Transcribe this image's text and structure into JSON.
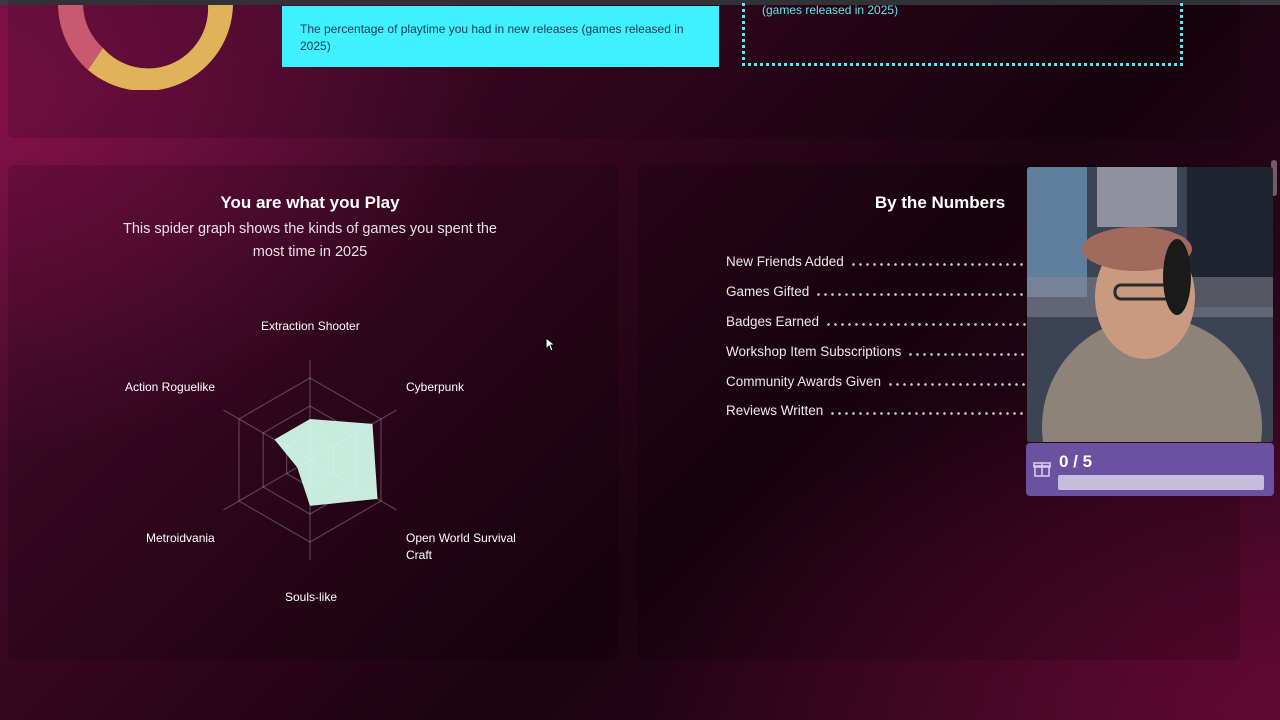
{
  "top": {
    "tooltip_text": "The percentage of playtime you had in new releases (games released in 2025)",
    "callout_text": "(games released in 2025)"
  },
  "spider": {
    "title": "You are what you Play",
    "subtitle": "This spider graph shows the kinds of games you spent the most time in 2025",
    "axes": [
      {
        "label": "Extraction Shooter",
        "value": 0.5
      },
      {
        "label": "Cyberpunk",
        "value": 0.88
      },
      {
        "label": "Open World Survival Craft",
        "value": 0.95
      },
      {
        "label": "Souls-like",
        "value": 0.56
      },
      {
        "label": "Metroidvania",
        "value": 0.18
      },
      {
        "label": "Action Roguelike",
        "value": 0.5
      }
    ],
    "fill_color": "#d6fff0"
  },
  "numbers": {
    "title": "By the Numbers",
    "stats": [
      {
        "label": "New Friends Added"
      },
      {
        "label": "Games Gifted"
      },
      {
        "label": "Badges Earned"
      },
      {
        "label": "Workshop Item Subscriptions"
      },
      {
        "label": "Community Awards Given"
      },
      {
        "label": "Reviews Written"
      }
    ]
  },
  "overlay": {
    "goal_count": "0 / 5",
    "goal_progress": 0,
    "icon": "gift-icon"
  }
}
